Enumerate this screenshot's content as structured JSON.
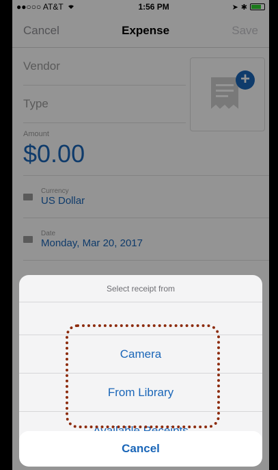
{
  "status_bar": {
    "carrier": "●●○○○ AT&T",
    "time": "1:56 PM",
    "wifi_icon": "wifi-icon",
    "bluetooth_icon": "bluetooth-icon",
    "battery_icon": "battery-icon"
  },
  "nav": {
    "cancel_label": "Cancel",
    "title": "Expense",
    "save_label": "Save"
  },
  "form": {
    "vendor_placeholder": "Vendor",
    "type_placeholder": "Type",
    "amount_label": "Amount",
    "amount_value": "$0.00",
    "currency_label": "Currency",
    "currency_value": "US Dollar",
    "date_label": "Date",
    "date_value": "Monday, Mar 20, 2017"
  },
  "receipt": {
    "icon": "receipt-icon",
    "add_icon": "plus-icon"
  },
  "action_sheet": {
    "title": "Select receipt from",
    "options": [
      "Camera",
      "From Library",
      "Available Receipts"
    ],
    "cancel_label": "Cancel"
  },
  "colors": {
    "accent": "#1a66b8",
    "annotation": "#8c2b0c"
  }
}
